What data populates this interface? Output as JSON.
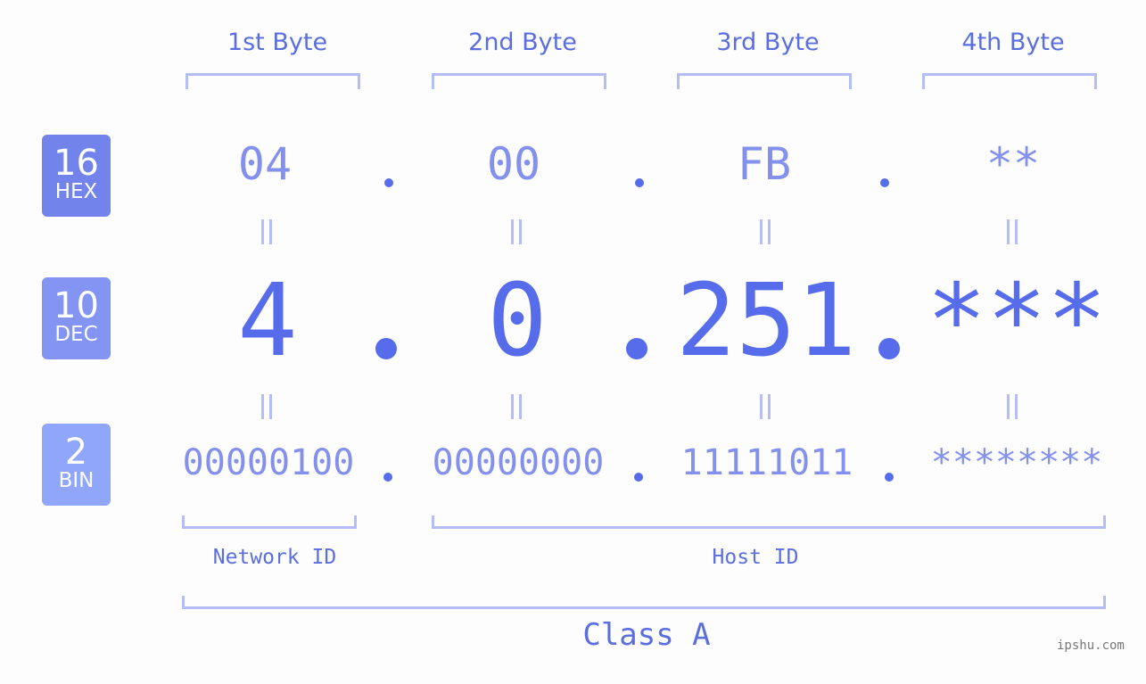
{
  "bytes": {
    "headers": [
      "1st Byte",
      "2nd Byte",
      "3rd Byte",
      "4th Byte"
    ]
  },
  "badges": {
    "hex": {
      "num": "16",
      "label": "HEX",
      "color": "#7383ec"
    },
    "dec": {
      "num": "10",
      "label": "DEC",
      "color": "#8394f2"
    },
    "bin": {
      "num": "2",
      "label": "BIN",
      "color": "#8fa6fa"
    }
  },
  "hex": [
    "04",
    "00",
    "FB",
    "**"
  ],
  "dec": [
    "4",
    "0",
    "251",
    "***"
  ],
  "bin": [
    "00000100",
    "00000000",
    "11111011",
    "********"
  ],
  "segments": {
    "network": "Network ID",
    "host": "Host ID",
    "class": "Class A"
  },
  "watermark": "ipshu.com",
  "colors": {
    "accent": "#566ceb",
    "light": "#8390ec",
    "bracket": "#b4bdf6"
  }
}
